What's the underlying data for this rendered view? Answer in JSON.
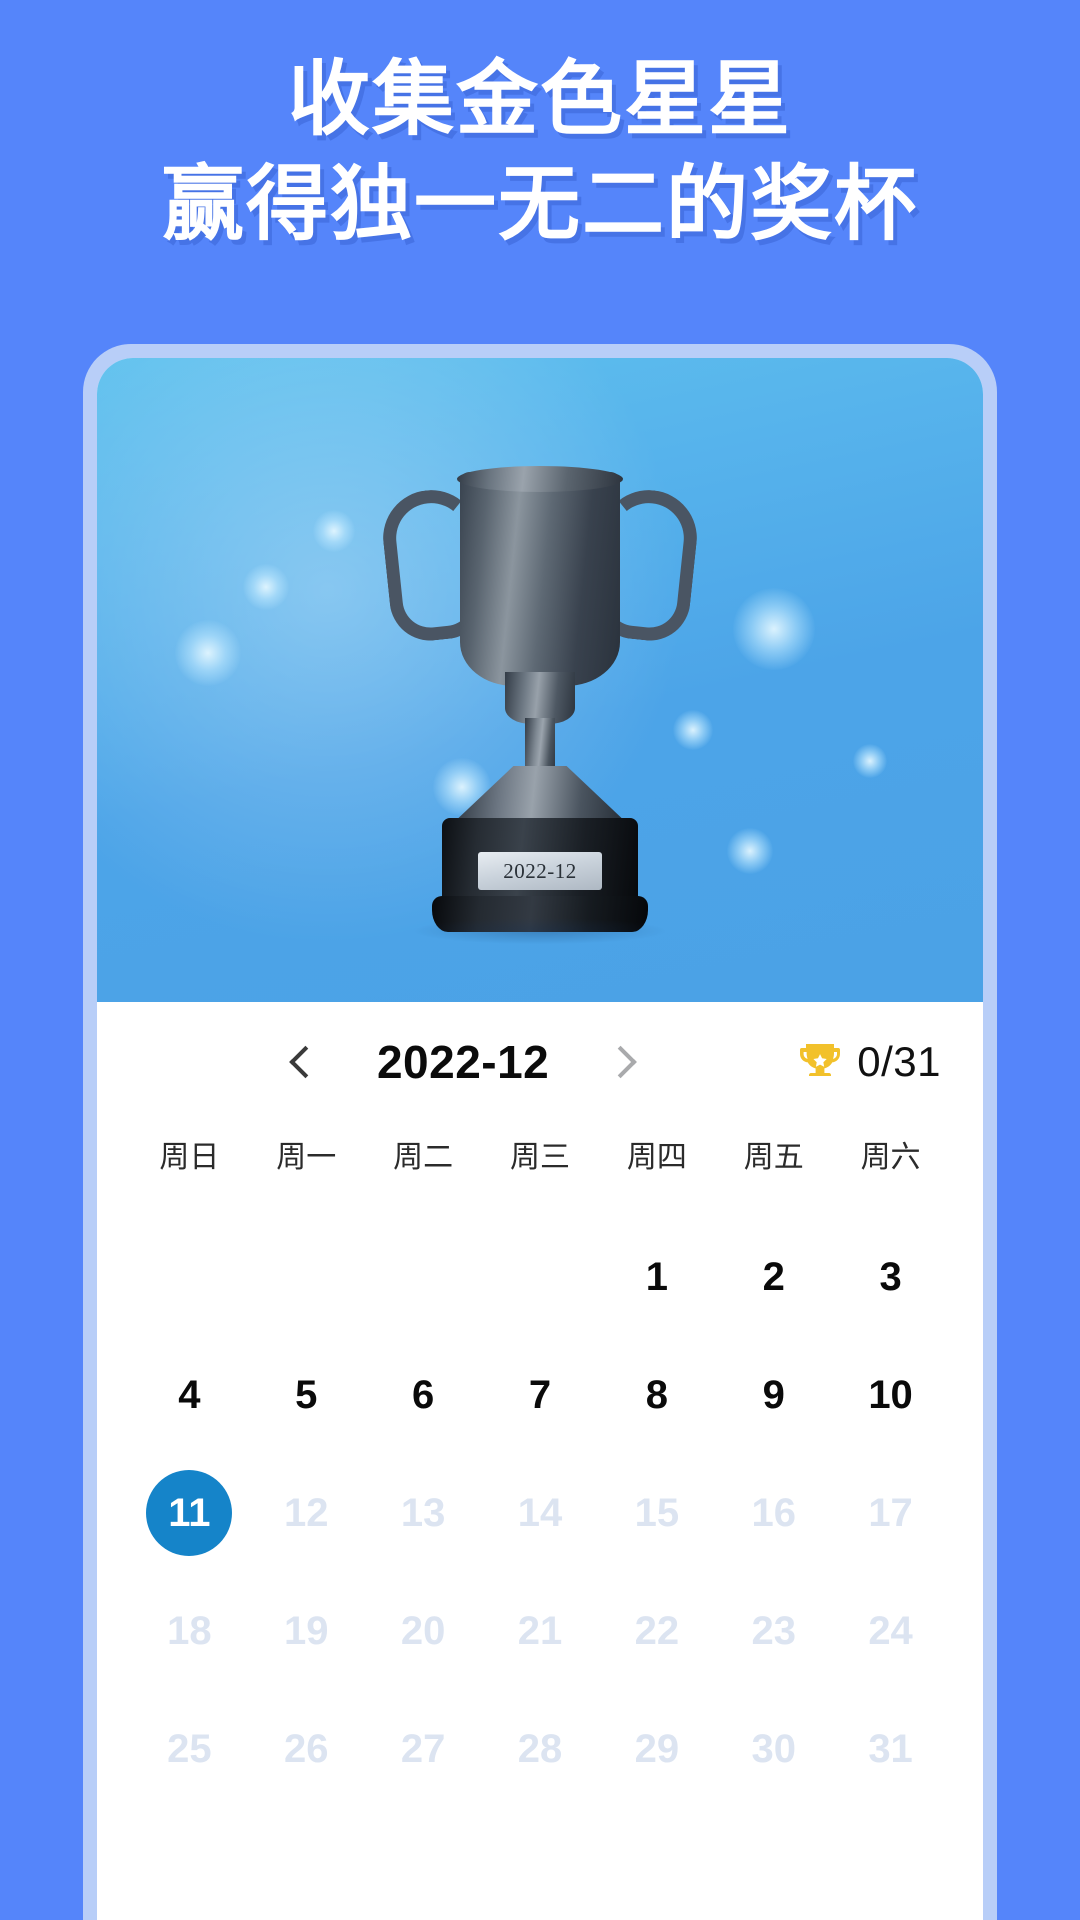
{
  "headline": {
    "line1": "收集金色星星",
    "line2": "赢得独一无二的奖杯"
  },
  "colors": {
    "background": "#5585FA",
    "card_border": "#B8CEF8",
    "hero_blue": "#4CA4E8",
    "selected_day": "#1584C9",
    "trophy_gold": "#F2C12B",
    "dim_day": "#DCE4F1"
  },
  "trophy_card": {
    "plate_label": "2022-12",
    "icon": "trophy-image"
  },
  "calendar": {
    "prev_icon": "chevron-left-icon",
    "next_icon": "chevron-right-icon",
    "title": "2022-12",
    "score": {
      "icon": "trophy-star-icon",
      "text": "0/31"
    },
    "weekdays": [
      "周日",
      "周一",
      "周二",
      "周三",
      "周四",
      "周五",
      "周六"
    ],
    "leading_blanks": 4,
    "selected_day": 11,
    "dim_from_day": 12,
    "days": [
      1,
      2,
      3,
      4,
      5,
      6,
      7,
      8,
      9,
      10,
      11,
      12,
      13,
      14,
      15,
      16,
      17,
      18,
      19,
      20,
      21,
      22,
      23,
      24,
      25,
      26,
      27,
      28,
      29,
      30,
      31
    ]
  }
}
